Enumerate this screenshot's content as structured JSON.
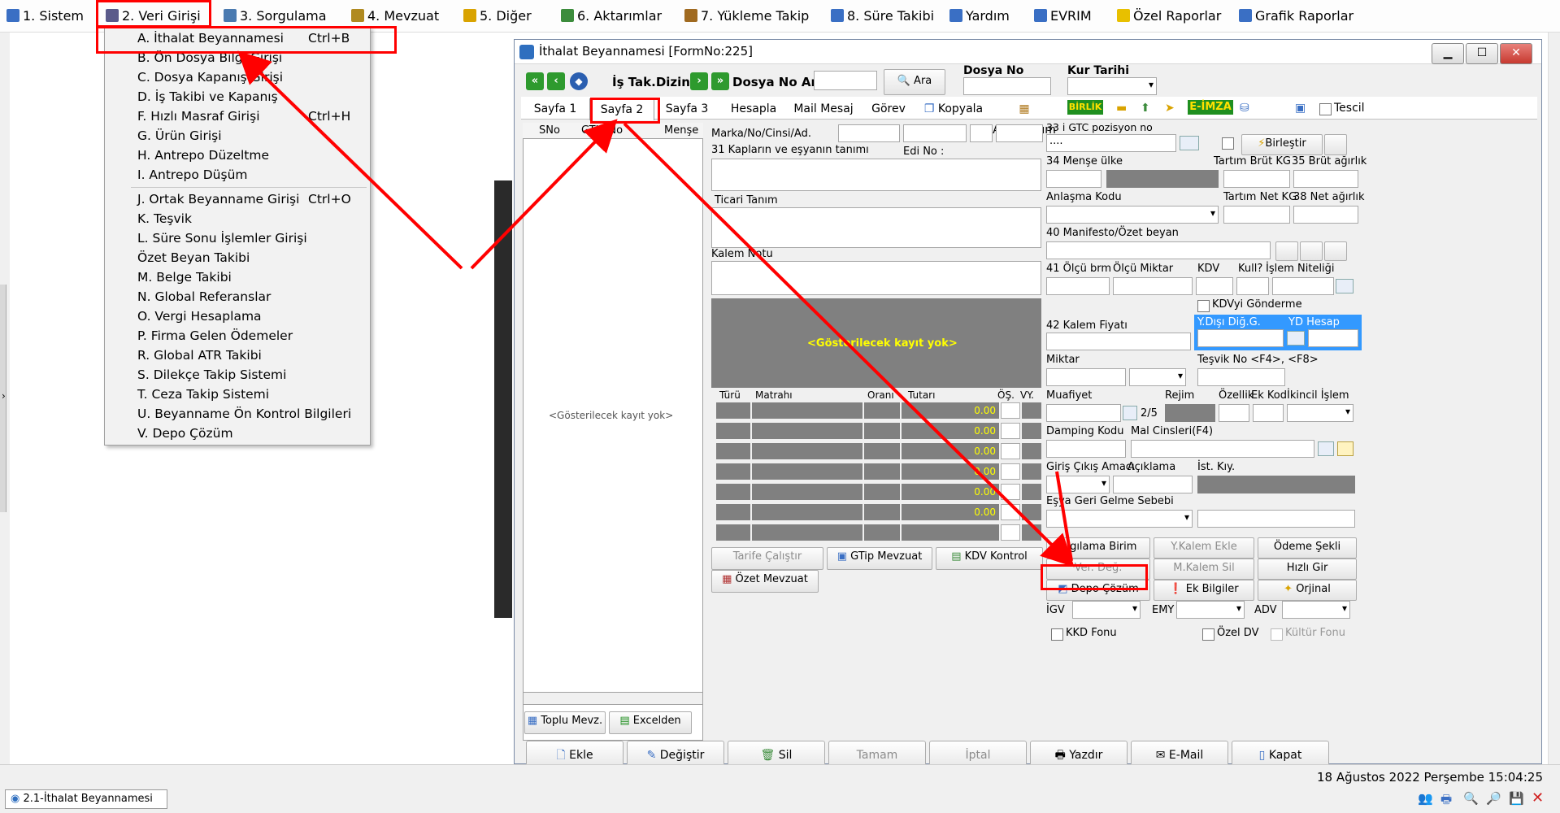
{
  "menubar": {
    "items": [
      {
        "label": "1.  Sistem",
        "color": "#3a6fc4"
      },
      {
        "label": "2.  Veri Girişi",
        "color": "#5a5a8a"
      },
      {
        "label": "3.  Sorgulama",
        "color": "#4a7ab0"
      },
      {
        "label": "4.  Mevzuat",
        "color": "#b08a20"
      },
      {
        "label": "5.  Diğer",
        "color": "#d9a300"
      },
      {
        "label": "6.  Aktarımlar",
        "color": "#3c8c3c"
      },
      {
        "label": "7.  Yükleme Takip",
        "color": "#a06a20"
      },
      {
        "label": "8. Süre Takibi",
        "color": "#3a6fc4"
      },
      {
        "label": "Yardım",
        "color": "#3a6fc4"
      },
      {
        "label": "EVRIM",
        "color": "#3a6fc4"
      },
      {
        "label": "Özel Raporlar",
        "color": "#e8c000"
      },
      {
        "label": "Grafik Raporlar",
        "color": "#3a6fc4"
      }
    ]
  },
  "dropdown": {
    "items": [
      {
        "label": "A.  İthalat Beyannamesi",
        "shortcut": "Ctrl+B"
      },
      {
        "label": "B.  Ön Dosya Bilgi Girişi",
        "shortcut": ""
      },
      {
        "label": "C.  Dosya Kapanış Girişi",
        "shortcut": ""
      },
      {
        "label": "D.  İş Takibi ve Kapanış",
        "shortcut": ""
      },
      {
        "label": "F.  Hızlı Masraf Girişi",
        "shortcut": "Ctrl+H"
      },
      {
        "label": "G.  Ürün Girişi",
        "shortcut": ""
      },
      {
        "label": "H.  Antrepo Düzeltme",
        "shortcut": ""
      },
      {
        "label": "I.   Antrepo Düşüm",
        "shortcut": ""
      },
      {
        "label": "J.  Ortak Beyanname Girişi",
        "shortcut": "Ctrl+O"
      },
      {
        "label": "K.  Teşvik",
        "shortcut": ""
      },
      {
        "label": "L.  Süre Sonu İşlemler Girişi",
        "shortcut": ""
      },
      {
        "label": "     Özet Beyan Takibi",
        "shortcut": ""
      },
      {
        "label": "M.  Belge Takibi",
        "shortcut": ""
      },
      {
        "label": "N.  Global Referanslar",
        "shortcut": ""
      },
      {
        "label": "O. Vergi Hesaplama",
        "shortcut": ""
      },
      {
        "label": "P. Firma Gelen Ödemeler",
        "shortcut": ""
      },
      {
        "label": "R. Global ATR Takibi",
        "shortcut": ""
      },
      {
        "label": "S. Dilekçe Takip Sistemi",
        "shortcut": ""
      },
      {
        "label": "T. Ceza Takip Sistemi",
        "shortcut": ""
      },
      {
        "label": "U. Beyanname Ön Kontrol Bilgileri",
        "shortcut": ""
      },
      {
        "label": "V. Depo Çözüm",
        "shortcut": ""
      }
    ]
  },
  "window": {
    "title": "İthalat Beyannamesi [FormNo:225]",
    "is_tak_dizin": "İş Tak.Dizin",
    "dosya_no_ara": "Dosya No Ara",
    "ara": "Ara",
    "dosya_no": "Dosya No",
    "kur_tarihi": "Kur Tarihi",
    "tabs": [
      "Sayfa 1",
      "Sayfa 2",
      "Sayfa 3",
      "Hesapla",
      "Mail Mesaj",
      "Görev",
      "Kopyala",
      "Ant.Düşüm",
      "BİRLİK",
      "E-İMZA",
      "Tescil"
    ],
    "grid_headers": [
      "SNo",
      "GTIP No",
      "Menşe"
    ],
    "empty_text": "<Gösterilecek kayıt yok>",
    "empty_text2": "<Gösterilecek kayıt yok>",
    "toplu_mevz": "Toplu Mevz.",
    "excelden": "Excelden",
    "middle": {
      "marka": "Marka/No/Cinsi/Ad.",
      "kaplar": "31 Kapların ve eşyanın tanımı",
      "edi_no": "Edi No :",
      "ticari_tanim": "Ticari Tanım",
      "kalem_notu": "Kalem Notu",
      "tax_headers": [
        "Türü",
        "Matrahı",
        "Oranı",
        "Tutarı",
        "ÖŞ.",
        "VY."
      ],
      "tax_value": "0.00",
      "tarife": "Tarife Çalıştır",
      "gtip_mevzuat": "GTip Mevzuat",
      "kdv_kontrol": "KDV Kontrol",
      "ozet_mevzuat": "Özet Mevzuat"
    },
    "right": {
      "gtc": "33 i GTC pozisyon no",
      "gtc_val": "....",
      "birlestir": "Birleştir",
      "mense_ulke": "34 Menşe ülke",
      "tartim_brut": "Tartım Brüt KG",
      "brut_agirlik": "35 Brüt ağırlık",
      "anlasma": "Anlaşma Kodu",
      "tartim_net": "Tartım Net KG",
      "net_agirlik": "38 Net ağırlık",
      "manifesto": "40 Manifesto/Özet beyan",
      "olcu_brm": "41 Ölçü brm",
      "olcu_miktar": "Ölçü Miktar",
      "kdv": "KDV",
      "kull": "Kull?",
      "islem_niteligi": "İşlem Niteliği",
      "kdv_gonderme": "KDVyi Gönderme",
      "kalem_fiyati": "42 Kalem Fiyatı",
      "ydisi": "Y.Dışı Diğ.G.",
      "yd_hesap": "YD Hesap",
      "miktar": "Miktar",
      "tesvik": "Teşvik No <F4>, <F8>",
      "muafiyet": "Muafiyet",
      "rejim": "Rejim",
      "ozellik": "Özellik",
      "ek_kod": "Ek Kod",
      "ikincil": "İkincil İşlem",
      "pager": "2/5",
      "damping": "Damping Kodu",
      "mal_cinsleri": "Mal Cinsleri(F4)",
      "giris_cikis": "Giriş Çıkış Amacı",
      "aciklama": "Açıklama",
      "ist_kiy": "İst. Kıy.",
      "esya_geri": "Eşya Geri Gelme Sebebi",
      "algilama": "Algılama Birim",
      "ykalem": "Y.Kalem Ekle",
      "odeme": "Ödeme Şekli",
      "ver_deg": "Ver. Değ.",
      "mkalem": "M.Kalem Sil",
      "hizli_gir": "Hızlı Gir",
      "depo_cozum": "Depo Çözüm",
      "ek_bilgiler": "Ek Bilgiler",
      "orjinal": "Orjinal",
      "igv": "İGV",
      "emy": "EMY",
      "adv": "ADV",
      "kkd": "KKD Fonu",
      "ozel_dv": "Özel DV",
      "kultur": "Kültür Fonu"
    },
    "bottom_buttons": [
      "Ekle",
      "Değiştir",
      "Sil",
      "Tamam",
      "İptal",
      "Yazdır",
      "E-Mail",
      "Kapat"
    ]
  },
  "status": {
    "datetime": "18 Ağustos 2022 Perşembe 15:04:25",
    "taskbar_item": "2.1-İthalat Beyannamesi"
  },
  "colors": {
    "accent_red": "#ff0000",
    "dark_gray": "#808080",
    "title_blue": "#3399ff"
  }
}
